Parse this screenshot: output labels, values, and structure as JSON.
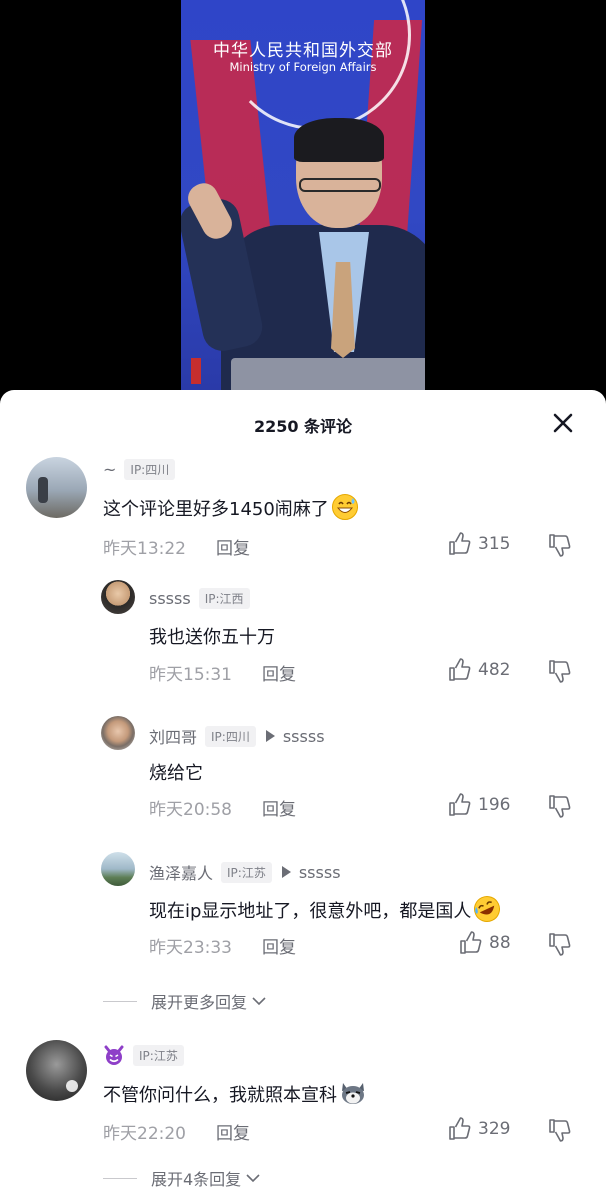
{
  "video": {
    "org_cn": "中华人民共和国外交部",
    "org_en": "Ministry of Foreign Affairs"
  },
  "sheet": {
    "title": "2250 条评论"
  },
  "comments": [
    {
      "user": "~",
      "ip": "IP:四川",
      "text": "这个评论里好多1450闹麻了",
      "emoji": "grinning-sweat-emoji",
      "time": "昨天13:22",
      "reply_label": "回复",
      "likes": "315"
    },
    {
      "user": "sssss",
      "ip": "IP:江西",
      "text": "我也送你五十万",
      "time": "昨天15:31",
      "reply_label": "回复",
      "likes": "482"
    },
    {
      "user": "刘四哥",
      "ip": "IP:四川",
      "reply_to": "sssss",
      "text": "烧给它",
      "time": "昨天20:58",
      "reply_label": "回复",
      "likes": "196"
    },
    {
      "user": "渔泽嘉人",
      "ip": "IP:江苏",
      "reply_to": "sssss",
      "text": "现在ip显示地址了，很意外吧，都是国人",
      "emoji": "rolling-laughing-emoji",
      "time": "昨天23:33",
      "reply_label": "回复",
      "likes": "88"
    },
    {
      "user": "",
      "user_emoji": "devil-emoji",
      "ip": "IP:江苏",
      "text": "不管你问什么，我就照本宣科",
      "emoji": "husky-emoji",
      "time": "昨天22:20",
      "reply_label": "回复",
      "likes": "329"
    }
  ],
  "expand_more": "展开更多回复",
  "expand_four": "展开4条回复",
  "colors": {
    "video_bg": "#2f45c8",
    "text_primary": "#161823",
    "text_secondary": "#6b6d75",
    "text_time": "#9fa0a6"
  }
}
